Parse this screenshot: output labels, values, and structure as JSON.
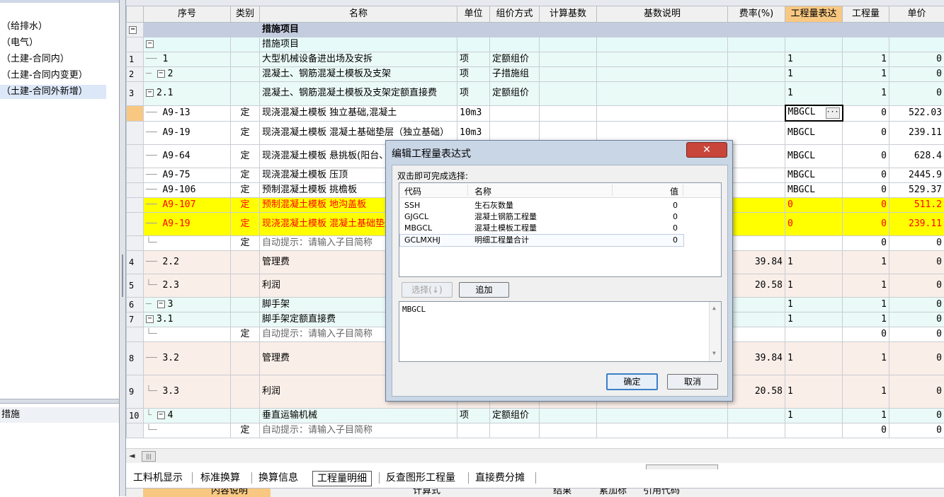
{
  "left_panel": {
    "items": [
      "（给排水）",
      "（电气）",
      "（土建-合同内）",
      "（土建-合同内变更）",
      "（土建-合同外新增）"
    ],
    "selected_index": 4,
    "bottom_item": "措施"
  },
  "grid": {
    "columns": [
      "序号",
      "类别",
      "名称",
      "单位",
      "组价方式",
      "计算基数",
      "基数说明",
      "费率(%)",
      "工程量表达",
      "工程量",
      "单价"
    ],
    "rows": [
      {
        "rn": "",
        "seq": "",
        "cat": "",
        "name": "措施项目",
        "unit": "",
        "method": "",
        "expr": "",
        "qty": "",
        "price": ""
      },
      {
        "rn": "",
        "seq": "",
        "cat": "",
        "name": "措施项目",
        "unit": "",
        "method": "",
        "expr": "",
        "qty": "",
        "price": ""
      },
      {
        "rn": "1",
        "seq": "1",
        "cat": "",
        "name": "大型机械设备进出场及安拆",
        "unit": "项",
        "method": "定额组价",
        "expr": "1",
        "qty": "1",
        "price": "0"
      },
      {
        "rn": "2",
        "seq": "2",
        "cat": "",
        "name": "混凝土、钢筋混凝土模板及支架",
        "unit": "项",
        "method": "子措施组",
        "expr": "1",
        "qty": "1",
        "price": "0"
      },
      {
        "rn": "3",
        "seq": "2.1",
        "cat": "",
        "name": "混凝土、钢筋混凝土模板及支架定额直接费",
        "unit": "项",
        "method": "定额组价",
        "expr": "1",
        "qty": "1",
        "price": "0"
      },
      {
        "rn": "",
        "seq": "A9-13",
        "cat": "定",
        "name": "现浇混凝土模板 独立基础,混凝土",
        "unit": "10m3",
        "method": "",
        "expr": "MBGCL",
        "qty": "0",
        "price": "522.03"
      },
      {
        "rn": "",
        "seq": "A9-19",
        "cat": "定",
        "name": "现浇混凝土模板 混凝土基础垫层（独立基础）",
        "unit": "10m3",
        "method": "",
        "expr": "MBGCL",
        "qty": "0",
        "price": "239.11"
      },
      {
        "rn": "",
        "seq": "A9-64",
        "cat": "定",
        "name": "现浇混凝土模板 悬挑板(阳台、雨篷)直形",
        "unit": "",
        "method": "",
        "expr": "MBGCL",
        "qty": "0",
        "price": "628.4"
      },
      {
        "rn": "",
        "seq": "A9-75",
        "cat": "定",
        "name": "现浇混凝土模板 压顶",
        "unit": "",
        "method": "",
        "expr": "MBGCL",
        "qty": "0",
        "price": "2445.9"
      },
      {
        "rn": "",
        "seq": "A9-106",
        "cat": "定",
        "name": "预制混凝土模板 挑檐板",
        "unit": "",
        "method": "",
        "expr": "MBGCL",
        "qty": "0",
        "price": "529.37"
      },
      {
        "rn": "",
        "seq": "A9-107",
        "cat": "定",
        "name": "预制混凝土模板 地沟盖板",
        "unit": "",
        "method": "",
        "expr": "0",
        "qty": "0",
        "price": "511.2"
      },
      {
        "rn": "",
        "seq": "A9-19",
        "cat": "定",
        "name": "现浇混凝土模板 混凝土基础垫层（地沟）",
        "unit": "",
        "method": "",
        "expr": "0",
        "qty": "0",
        "price": "239.11"
      },
      {
        "rn": "",
        "seq": "",
        "cat": "定",
        "name": "自动提示：请输入子目简称",
        "unit": "",
        "method": "",
        "expr": "",
        "qty": "0",
        "price": "0"
      },
      {
        "rn": "4",
        "seq": "2.2",
        "cat": "",
        "name": "管理费",
        "unit": "",
        "method": "",
        "rate": "39.84",
        "expr": "1",
        "qty": "1",
        "price": "0"
      },
      {
        "rn": "5",
        "seq": "2.3",
        "cat": "",
        "name": "利润",
        "unit": "",
        "method": "",
        "rate": "20.58",
        "expr": "1",
        "qty": "1",
        "price": "0"
      },
      {
        "rn": "6",
        "seq": "3",
        "cat": "",
        "name": "脚手架",
        "unit": "",
        "method": "",
        "expr": "1",
        "qty": "1",
        "price": "0"
      },
      {
        "rn": "7",
        "seq": "3.1",
        "cat": "",
        "name": "脚手架定额直接费",
        "unit": "",
        "method": "",
        "expr": "1",
        "qty": "1",
        "price": "0"
      },
      {
        "rn": "",
        "seq": "",
        "cat": "定",
        "name": "自动提示：请输入子目简称",
        "unit": "",
        "method": "",
        "expr": "",
        "qty": "0",
        "price": "0"
      },
      {
        "rn": "8",
        "seq": "3.2",
        "cat": "",
        "name": "管理费",
        "unit": "",
        "method": "",
        "rate": "39.84",
        "expr": "1",
        "qty": "1",
        "price": "0"
      },
      {
        "rn": "9",
        "seq": "3.3",
        "cat": "",
        "name": "利润",
        "unit": "",
        "method": "",
        "rate": "20.58",
        "expr": "1",
        "qty": "1",
        "price": "0"
      },
      {
        "rn": "10",
        "seq": "4",
        "cat": "",
        "name": "垂直运输机械",
        "unit": "项",
        "method": "定额组价",
        "expr": "1",
        "qty": "1",
        "price": "0"
      },
      {
        "rn": "",
        "seq": "",
        "cat": "定",
        "name": "自动提示：请输入子目简称",
        "unit": "",
        "method": "",
        "expr": "",
        "qty": "0",
        "price": "0"
      }
    ],
    "ellipsis": "···",
    "toggle_minus": "−"
  },
  "bottom_tabs": {
    "tabs": [
      "工料机显示",
      "标准换算",
      "换算信息",
      "工程量明细",
      "反查图形工程量",
      "直接费分摊"
    ],
    "active_index": 3
  },
  "bottom_table": {
    "headers": [
      "内容说明",
      "计算式",
      "结果",
      "累加标",
      "引用代码"
    ]
  },
  "scroll_thumb_glyph": "|||",
  "scroll_left_glyph": "◄",
  "dialog": {
    "title": "编辑工程量表达式",
    "close_glyph": "✕",
    "hint": "双击即可完成选择:",
    "list_headers": [
      "代码",
      "名称",
      "值"
    ],
    "list_rows": [
      {
        "code": "SSH",
        "name": "生石灰数量",
        "value": "0"
      },
      {
        "code": "GJGCL",
        "name": "混凝土钢筋工程量",
        "value": "0"
      },
      {
        "code": "MBGCL",
        "name": "混凝土模板工程量",
        "value": "0"
      },
      {
        "code": "GCLMXHJ",
        "name": "明细工程量合计",
        "value": "0"
      }
    ],
    "select_button": "选择(↓)",
    "add_button": "追加",
    "expression": "MBGCL",
    "ok_button": "确定",
    "cancel_button": "取消",
    "scroll_up": "▲",
    "scroll_down": "▼"
  },
  "colors": {
    "header_highlight": "#f8c882",
    "row_highlight": "#ffff00",
    "row_highlight_text": "#ff0000",
    "group_row": "#c4cce0"
  }
}
